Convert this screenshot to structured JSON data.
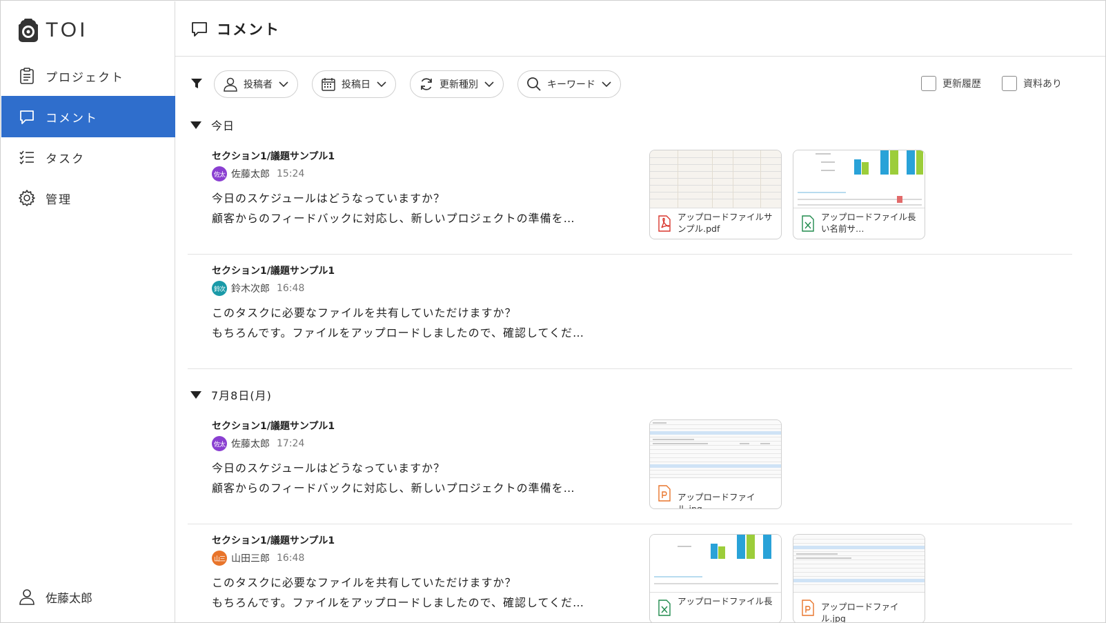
{
  "app": {
    "logo_text": "TOI"
  },
  "sidebar": {
    "items": [
      {
        "label": "プロジェクト",
        "icon": "clipboard-icon"
      },
      {
        "label": "コメント",
        "icon": "comment-icon",
        "active": true
      },
      {
        "label": "タスク",
        "icon": "checklist-icon"
      },
      {
        "label": "管理",
        "icon": "gear-icon"
      }
    ],
    "user_name": "佐藤太郎"
  },
  "header": {
    "title": "コメント"
  },
  "filters": {
    "poster": "投稿者",
    "date": "投稿日",
    "update_type": "更新種別",
    "keyword": "キーワード",
    "history_label": "更新履歴",
    "has_attachment_label": "資料あり"
  },
  "groups": [
    {
      "heading": "今日",
      "comments": [
        {
          "section": "セクション1/議題サンプル1",
          "avatar_text": "佐太",
          "avatar_color": "#8a3fd1",
          "author": "佐藤太郎",
          "time": "15:24",
          "line1": "今日のスケジュールはどうなっていますか？",
          "line2": "顧客からのフィードバックに対応し、新しいプロジェクトの準備を…",
          "attachments": [
            {
              "name": "アップロードファイルサンプル.pdf",
              "type": "pdf"
            },
            {
              "name": "アップロードファイル長い名前サ…",
              "type": "xlsx"
            }
          ]
        },
        {
          "section": "セクション1/議題サンプル1",
          "avatar_text": "鈴次",
          "avatar_color": "#1a9aa8",
          "author": "鈴木次郎",
          "time": "16:48",
          "line1": "このタスクに必要なファイルを共有していただけますか？",
          "line2": "もちろんです。ファイルをアップロードしましたので、確認してくだ…",
          "attachments": []
        }
      ]
    },
    {
      "heading": "7月8日(月)",
      "comments": [
        {
          "section": "セクション1/議題サンプル1",
          "avatar_text": "佐太",
          "avatar_color": "#8a3fd1",
          "author": "佐藤太郎",
          "time": "17:24",
          "line1": "今日のスケジュールはどうなっていますか？",
          "line2": "顧客からのフィードバックに対応し、新しいプロジェクトの準備を…",
          "attachments": [
            {
              "name": "アップロードファイル.jpg",
              "type": "pptx"
            }
          ]
        },
        {
          "section": "セクション1/議題サンプル1",
          "avatar_text": "山三",
          "avatar_color": "#e8742a",
          "author": "山田三郎",
          "time": "16:48",
          "line1": "このタスクに必要なファイルを共有していただけますか？",
          "line2": "もちろんです。ファイルをアップロードしましたので、確認してくだ…",
          "attachments": [
            {
              "name": "アップロードファイル長",
              "type": "xlsx"
            },
            {
              "name": "アップロードファイル.jpg",
              "type": "pptx"
            }
          ]
        }
      ]
    }
  ],
  "colors": {
    "accent": "#2f6ecc",
    "pdf": "#d9352c",
    "xlsx": "#1f8a4c",
    "pptx": "#e8742a"
  }
}
